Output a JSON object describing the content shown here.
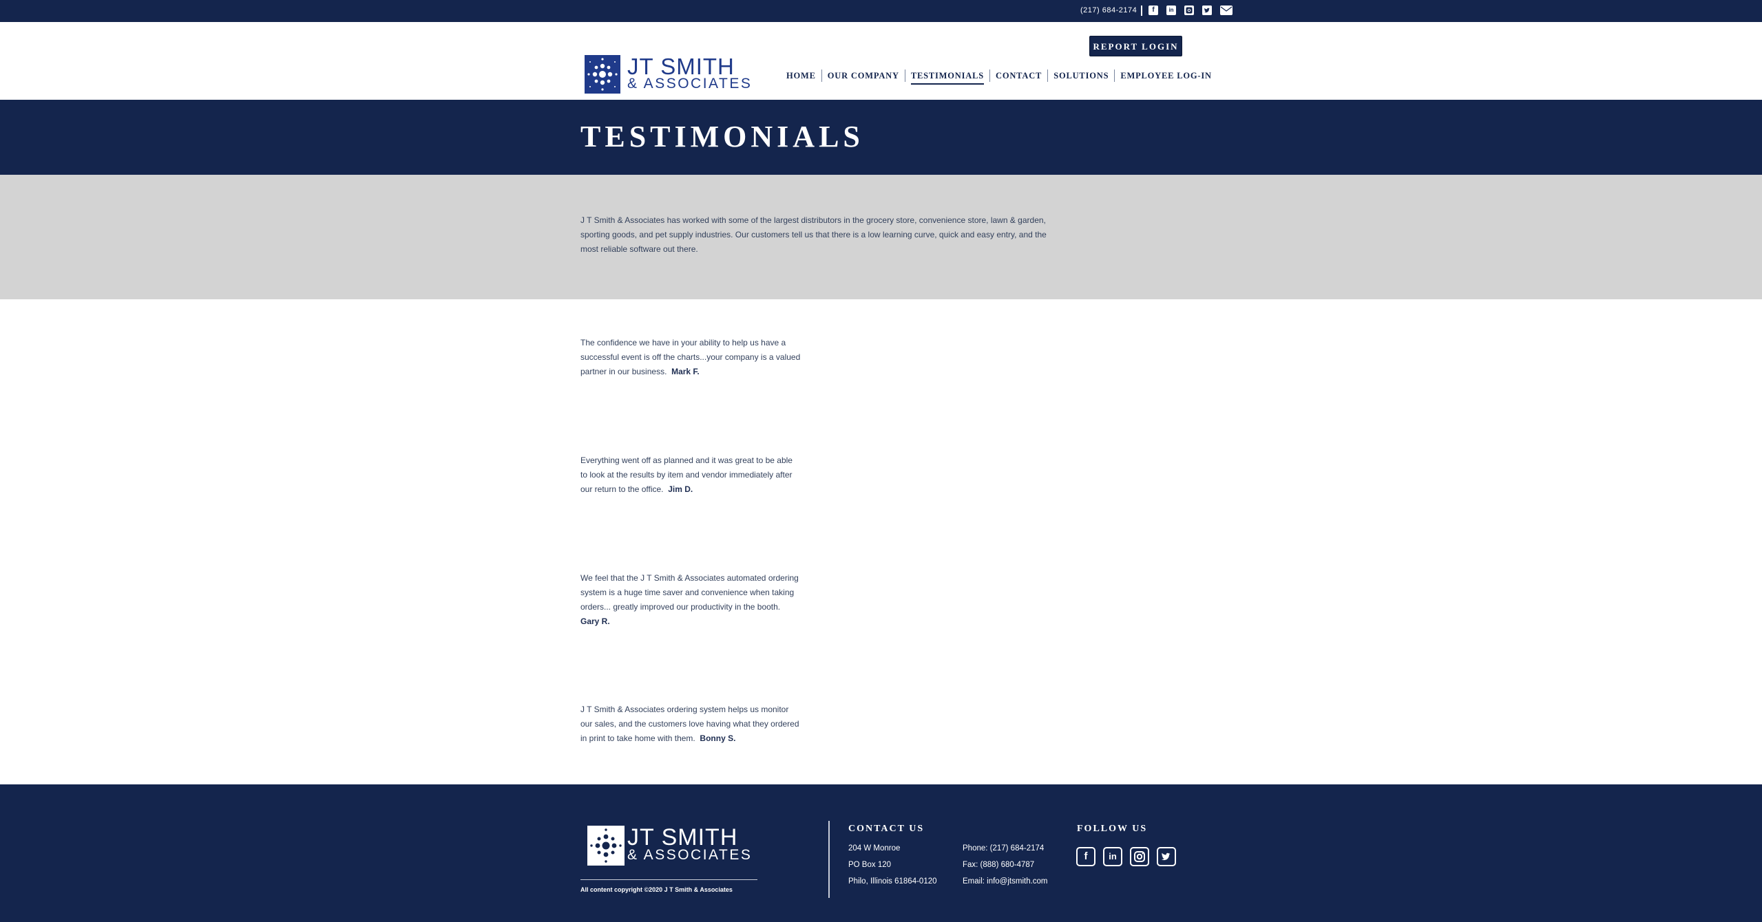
{
  "topbar": {
    "phone": "(217) 684-2174",
    "icons": [
      "facebook-icon",
      "linkedin-icon",
      "instagram-icon",
      "twitter-icon",
      "email-icon"
    ]
  },
  "header": {
    "logo_name": "JT SMITH",
    "logo_sub": "& ASSOCIATES",
    "report_login": "REPORT LOGIN",
    "nav": [
      "HOME",
      "OUR COMPANY",
      "TESTIMONIALS",
      "CONTACT",
      "SOLUTIONS",
      "EMPLOYEE LOG-IN"
    ],
    "active_nav": "TESTIMONIALS"
  },
  "banner": {
    "title": "TESTIMONIALS"
  },
  "intro": {
    "text": "J T Smith & Associates has worked with some of the largest distributors in the grocery store, convenience store, lawn & garden, sporting goods, and pet supply industries. Our customers tell us that there is a low learning curve, quick and easy entry, and the most reliable software out there."
  },
  "testimonials": [
    {
      "quote": "The confidence we have in your ability to help us have a successful event is off the charts...your company is a valued partner in our business.",
      "author": "Mark F."
    },
    {
      "quote": "Everything went off as planned and it was great to be able to look at the results by item and vendor immediately after our return to the office.",
      "author": "Jim D."
    },
    {
      "quote": "We feel that the J T Smith & Associates automated ordering system is a huge time saver and convenience when taking orders... greatly improved our productivity in the booth.",
      "author": "Gary R."
    },
    {
      "quote": "J T Smith & Associates ordering system helps us monitor our sales, and the customers love having what they ordered in print to take home with them.",
      "author": "Bonny S."
    }
  ],
  "footer": {
    "logo_name": "JT SMITH",
    "logo_sub": "& ASSOCIATES",
    "copyright": "All content copyright ©2020 J T Smith & Associates",
    "contact_heading": "CONTACT US",
    "address": [
      "204 W Monroe",
      "PO Box 120",
      "Philo, Illinois 61864-0120"
    ],
    "phone": "Phone: (217) 684-2174",
    "fax": "Fax: (888) 680-4787",
    "email": "Email: info@jtsmith.com",
    "follow_heading": "FOLLOW US",
    "social_icons": [
      "facebook-icon",
      "linkedin-icon",
      "instagram-icon",
      "twitter-icon"
    ]
  },
  "colors": {
    "navy": "#14254d",
    "logo_blue": "#1f3a8a",
    "intro_gray": "#d3d3d3",
    "body_text": "#33415c"
  }
}
